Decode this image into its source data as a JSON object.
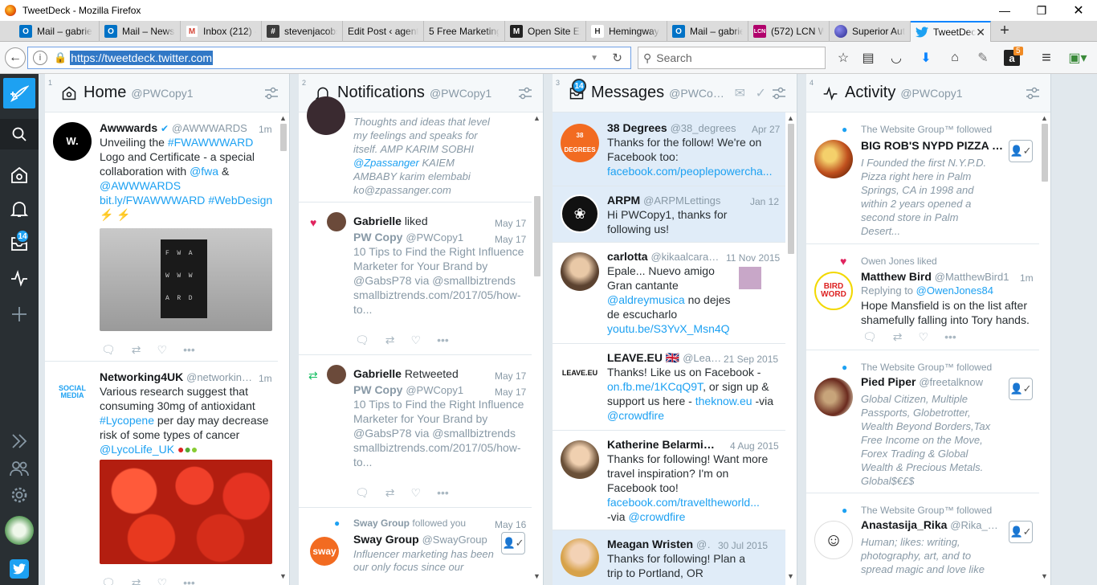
{
  "window": {
    "title": "TweetDeck - Mozilla Firefox"
  },
  "tabs": [
    {
      "label": "Mail – gabrie",
      "icon": "outlook-icon",
      "color": "#0072c6"
    },
    {
      "label": "Mail – Newsl",
      "icon": "outlook-icon",
      "color": "#0072c6"
    },
    {
      "label": "Inbox (212) -",
      "icon": "gmail-icon",
      "color": "#d44638"
    },
    {
      "label": "stevenjacobs",
      "icon": "slack-icon",
      "color": "#3c3c3c"
    },
    {
      "label": "Edit Post ‹ agenty",
      "icon": "",
      "color": ""
    },
    {
      "label": "5 Free Marketing",
      "icon": "",
      "color": ""
    },
    {
      "label": "Open Site Exp",
      "icon": "moz-icon",
      "color": "#222"
    },
    {
      "label": "Hemingway",
      "icon": "hemingway-icon",
      "color": "#fff"
    },
    {
      "label": "Mail – gabrie",
      "icon": "outlook-icon",
      "color": "#0072c6"
    },
    {
      "label": "(572) LCN W",
      "icon": "lcn-icon",
      "color": "#b0006b"
    },
    {
      "label": "Superior Auth",
      "icon": "globe-icon",
      "color": "#3a3aa8"
    },
    {
      "label": "TweetDeck",
      "icon": "twitter-icon",
      "color": "#1da1f2"
    }
  ],
  "nav": {
    "url": "https://tweetdeck.twitter.com",
    "search_placeholder": "Search",
    "amazon_badge": "5"
  },
  "sidebar": {
    "messages_badge": "14"
  },
  "columns": {
    "home": {
      "number": "1",
      "title": "Home",
      "account": "@PWCopy1"
    },
    "notifications": {
      "number": "2",
      "title": "Notifications",
      "account": "@PWCopy1"
    },
    "messages": {
      "number": "3",
      "title": "Messages",
      "account": "@PWCo…",
      "badge": "14"
    },
    "activity": {
      "number": "4",
      "title": "Activity",
      "account": "@PWCopy1"
    }
  },
  "home_feed": [
    {
      "name": "Awwwards",
      "handle": "@AWWWARDS",
      "time": "1m",
      "text_1": "Unveiling the ",
      "hashtag_1": "#FWAWWWARD",
      "text_2": "Logo and Certificate - a special collaboration with ",
      "mention_1": "@fwa",
      "text_3": " & ",
      "mention_2": "@AWWWARDS",
      "link_1": "bit.ly/FWAWWWARD",
      "hashtag_2": "#WebDesign",
      "emoji": "⚡ ⚡",
      "book_letters": "F  W  A\nW  W  W\nA  R  D"
    },
    {
      "name": "Networking4UK",
      "handle": "@networkin…",
      "time": "1m",
      "text_1": "Various research suggest that consuming 30mg of antioxidant ",
      "hashtag_1": "#Lycopene",
      "text_2": " per day may decrease risk of some types of cancer",
      "mention_1": "@LycoLife_UK",
      "avatar_text": "SOCIAL MEDIA"
    }
  ],
  "notifications_feed": [
    {
      "text": "Thoughts and ideas that level my feelings and speaks for itself. AMP KARIM SOBHI ",
      "mention": "@Zpassanger",
      "text_2": " KAIEM AMBABY karim elembabi ko@zpassanger.com"
    },
    {
      "actor": "Gabrielle",
      "action": "liked",
      "time": "May 17",
      "author": "PW Copy",
      "handle": "@PWCopy1",
      "time2": "May 17",
      "body": "10 Tips to Find the Right Influence Marketer for Your Brand by @GabsP78  via @smallbiztrends smallbiztrends.com/2017/05/how-to..."
    },
    {
      "actor": "Gabrielle",
      "action": "Retweeted",
      "time": "May 17",
      "author": "PW Copy",
      "handle": "@PWCopy1",
      "time2": "May 17",
      "body": "10 Tips to Find the Right Influence Marketer for Your Brand by @GabsP78  via @smallbiztrends smallbiztrends.com/2017/05/how-to..."
    },
    {
      "actor": "Sway Group",
      "action": "followed you",
      "time": "May 16",
      "name": "Sway Group",
      "handle": "@SwayGroup",
      "bio": "Influencer marketing has been our only focus since our",
      "avatar_text": "sway"
    }
  ],
  "messages_feed": [
    {
      "name": "38 Degrees",
      "handle": "@38_degrees",
      "time": "Apr 27",
      "text": "Thanks for the follow! We're on Facebook too: ",
      "link": "facebook.com/peoplepowercha...",
      "avatar_text": "38 DEGREES"
    },
    {
      "name": "ARPM",
      "handle": "@ARPMLettings",
      "time": "Jan 12",
      "text": "Hi PWCopy1, thanks for following us!"
    },
    {
      "name": "carlotta",
      "handle": "@kikaalcara…",
      "time": "11 Nov 2015",
      "text_1": "Epale... Nuevo amigo Gran cantante ",
      "mention": "@aldreymusica",
      "text_2": " no dejes de escucharlo ",
      "link": "youtu.be/S3YvX_Msn4Q"
    },
    {
      "name": "LEAVE.EU",
      "flag": "🇬🇧",
      "handle": "@Lea…",
      "time": "21 Sep 2015",
      "text_1": "Thanks! Like us on Facebook - ",
      "link_1": "on.fb.me/1KCqQ9T",
      "text_2": ", or sign up & support us here - ",
      "link_2": "theknow.eu",
      "text_3": " -via ",
      "mention": "@crowdfire",
      "avatar_text": "LEAVE.EU"
    },
    {
      "name": "Katherine Belarmi…",
      "handle": "",
      "time": "4 Aug 2015",
      "text_1": "Thanks for following! Want more travel inspiration? I'm on Facebook too! ",
      "link": "facebook.com/traveltheworld...",
      "text_2": "-via ",
      "mention": "@crowdfire"
    },
    {
      "name": "Meagan Wristen",
      "handle": "@…",
      "time": "30 Jul 2015",
      "text": "Thanks for following! Plan a trip to Portland, OR"
    }
  ],
  "activity_feed": [
    {
      "actor": "The Website Group™",
      "action": "followed",
      "name": "BIG ROB'S NYPD PIZZA …",
      "bio": "I Founded the first N.Y.P.D. Pizza right here in Palm Springs, CA in 1998 and within 2 years opened a second store in Palm Desert..."
    },
    {
      "actor": "Owen Jones",
      "action": "liked",
      "name": "Matthew Bird",
      "handle": "@MatthewBird1",
      "time": "1m",
      "reply_prefix": "Replying to ",
      "reply_to": "@OwenJones84",
      "text": "Hope Mansfield is on the list after shamefully falling into Tory hands.",
      "avatar_text": "BIRD WORD"
    },
    {
      "actor": "The Website Group™",
      "action": "followed",
      "name": "Pied Piper",
      "handle": "@freetalknow",
      "bio": "Global Citizen, Multiple Passports, Globetrotter, Wealth Beyond Borders,Tax Free Income on the Move, Forex Trading & Global Wealth & Precious Metals. Global$€£$"
    },
    {
      "actor": "The Website Group™",
      "action": "followed",
      "name": "Anastasija_Rika",
      "handle": "@Rika_…",
      "bio": "Human; likes: writing, photography, art, and to spread magic and love like"
    }
  ]
}
